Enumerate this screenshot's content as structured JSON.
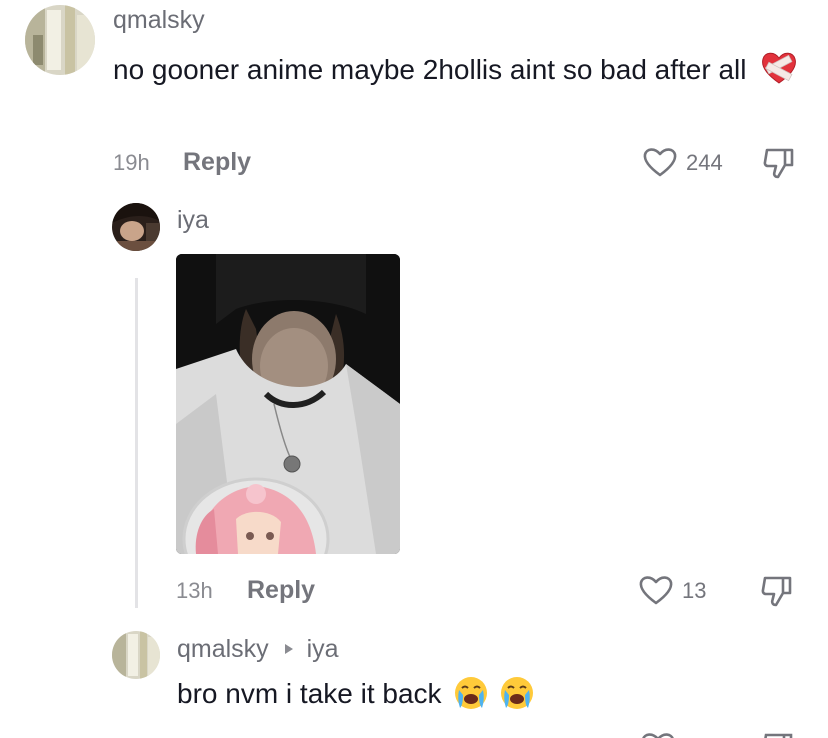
{
  "comment1": {
    "username": "qmalsky",
    "text": "no gooner anime maybe 2hollis aint so bad after all",
    "time": "19h",
    "reply_label": "Reply",
    "likes": "244",
    "emoji": "heart-with-bandage"
  },
  "comment2": {
    "username": "iya",
    "time": "13h",
    "reply_label": "Reply",
    "likes": "13"
  },
  "comment3": {
    "username": "qmalsky",
    "reply_to": "iya",
    "text": "bro nvm i take it back",
    "emoji": "loudly-crying-face"
  },
  "colors": {
    "text": "#161823",
    "secondary": "#74757c",
    "thread_line": "#e3e3e6"
  }
}
